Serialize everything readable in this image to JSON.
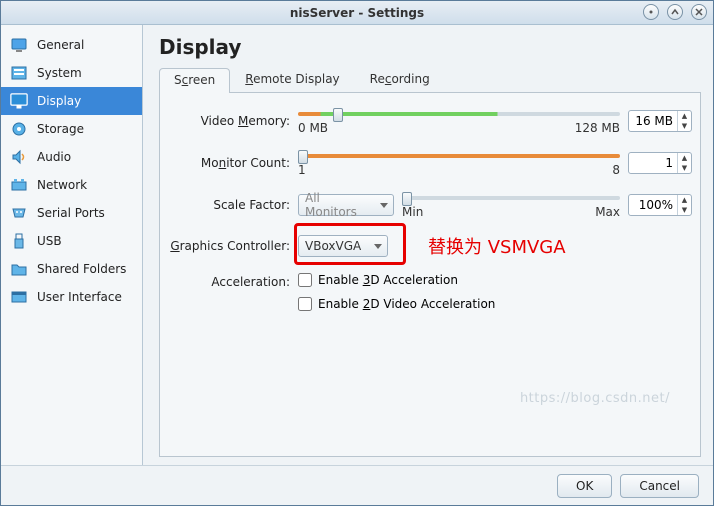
{
  "window": {
    "title": "nisServer - Settings"
  },
  "sidebar": {
    "items": [
      {
        "label": "General"
      },
      {
        "label": "System"
      },
      {
        "label": "Display"
      },
      {
        "label": "Storage"
      },
      {
        "label": "Audio"
      },
      {
        "label": "Network"
      },
      {
        "label": "Serial Ports"
      },
      {
        "label": "USB"
      },
      {
        "label": "Shared Folders"
      },
      {
        "label": "User Interface"
      }
    ]
  },
  "page": {
    "title": "Display",
    "tabs": [
      {
        "label_pre": "S",
        "label_u": "c",
        "label_post": "reen"
      },
      {
        "label_pre": "",
        "label_u": "R",
        "label_post": "emote Display"
      },
      {
        "label_pre": "Re",
        "label_u": "c",
        "label_post": "ording"
      }
    ],
    "videoMemory": {
      "label_pre": "Video ",
      "label_u": "M",
      "label_post": "emory:",
      "min": "0 MB",
      "max": "128 MB",
      "value": "16 MB"
    },
    "monitorCount": {
      "label_pre": "Mo",
      "label_u": "n",
      "label_post": "itor Count:",
      "min": "1",
      "max": "8",
      "value": "1"
    },
    "scaleFactor": {
      "label": "Scale Factor:",
      "combo": "All Monitors",
      "min": "Min",
      "max": "Max",
      "value": "100%"
    },
    "graphicsController": {
      "label_u": "G",
      "label_post": "raphics Controller:",
      "value": "VBoxVGA"
    },
    "annotation": "替换为 VSMVGA",
    "acceleration": {
      "label": "Acceleration:",
      "opt3d_pre": "Enable ",
      "opt3d_u": "3",
      "opt3d_post": "D Acceleration",
      "opt2d_pre": "Enable ",
      "opt2d_u": "2",
      "opt2d_post": "D Video Acceleration"
    }
  },
  "footer": {
    "ok": "OK",
    "cancel": "Cancel"
  },
  "watermark": "https://blog.csdn.net/"
}
